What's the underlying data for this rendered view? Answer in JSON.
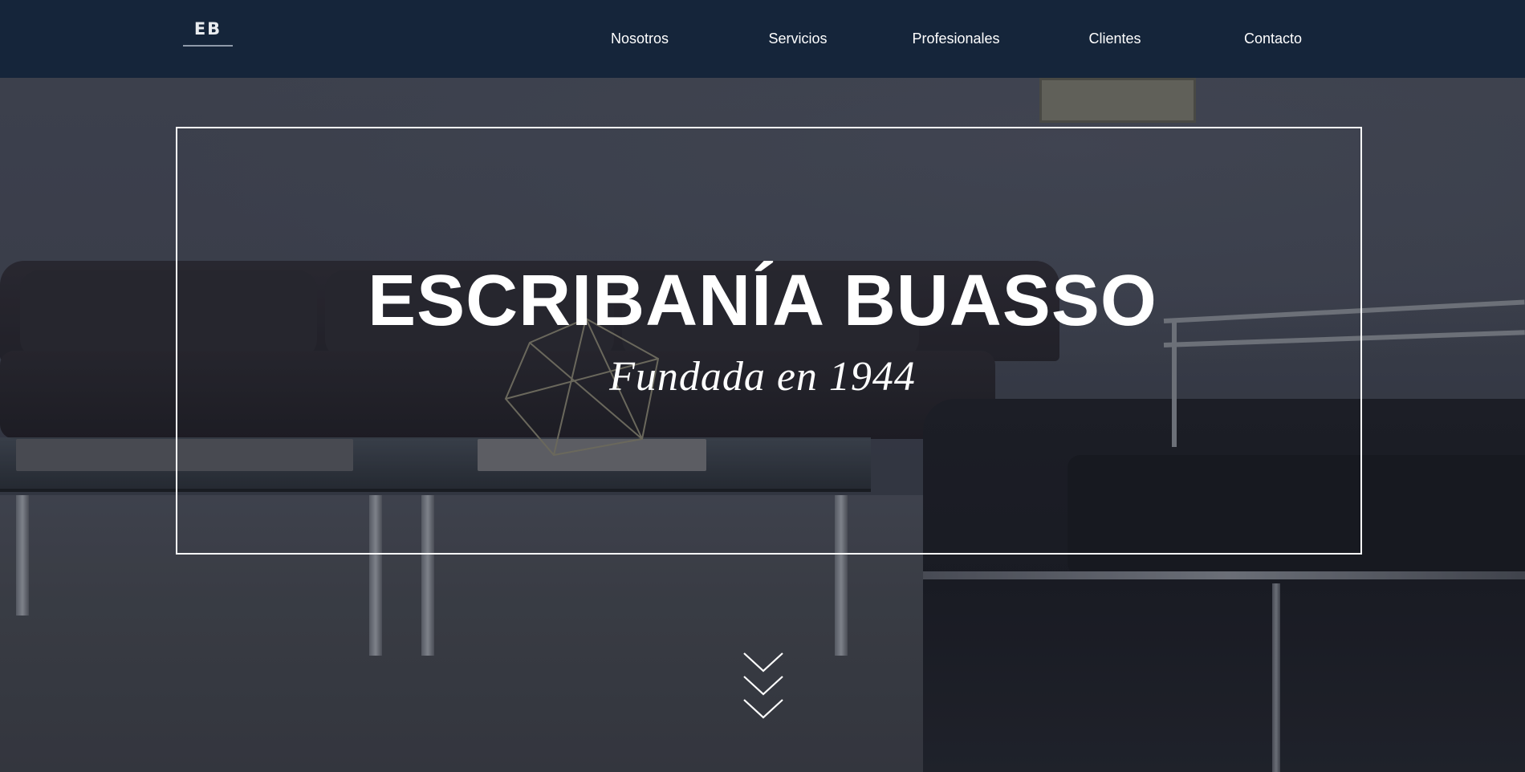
{
  "header": {
    "logo_text": "EB",
    "nav": [
      {
        "label": "Nosotros"
      },
      {
        "label": "Servicios"
      },
      {
        "label": "Profesionales"
      },
      {
        "label": "Clientes"
      },
      {
        "label": "Contacto"
      }
    ]
  },
  "hero": {
    "title": "ESCRIBANÍA BUASSO",
    "subtitle": "Fundada en 1944",
    "scroll_icon": "triple-chevron-down-icon"
  },
  "colors": {
    "navbar_bg": "#15253a",
    "text": "#ffffff",
    "frame_border": "#ffffff"
  }
}
